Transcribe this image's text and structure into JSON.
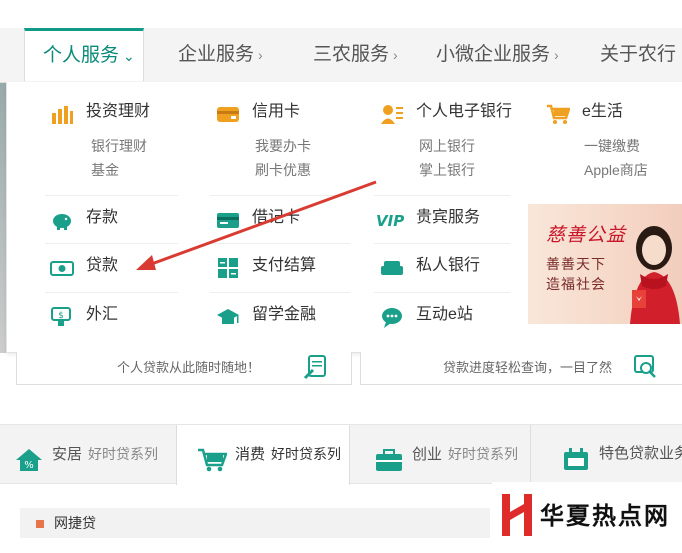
{
  "nav": {
    "tabs": [
      {
        "label": "个人服务",
        "active": true
      },
      {
        "label": "企业服务"
      },
      {
        "label": "三农服务"
      },
      {
        "label": "小微企业服务"
      },
      {
        "label": "关于农行"
      }
    ],
    "chevron_down": "⌄",
    "chevron_right": "›"
  },
  "menu": {
    "col1": {
      "head": "投资理财",
      "subs": [
        "银行理财",
        "基金"
      ],
      "items": [
        "存款",
        "贷款",
        "外汇"
      ]
    },
    "col2": {
      "head": "信用卡",
      "subs": [
        "我要办卡",
        "刷卡优惠"
      ],
      "items": [
        "借记卡",
        "支付结算",
        "留学金融"
      ]
    },
    "col3": {
      "head": "个人电子银行",
      "subs": [
        "网上银行",
        "掌上银行"
      ],
      "items": [
        "贵宾服务",
        "私人银行",
        "互动e站"
      ]
    },
    "col4": {
      "head": "e生活",
      "subs": [
        "一键缴费",
        "Apple商店"
      ]
    }
  },
  "promo": {
    "title": "慈善公益",
    "line1": "善善天下",
    "line2": "造福社会"
  },
  "cards": {
    "left": "个人贷款从此随时随地！",
    "right": "贷款进度轻松查询，一目了然"
  },
  "categories": [
    {
      "label": "安居",
      "sub": "好时贷系列"
    },
    {
      "label": "消费",
      "sub": "好时贷系列",
      "active": true
    },
    {
      "label": "创业",
      "sub": "好时贷系列"
    },
    {
      "label": "特色贷款业务",
      "sub": ""
    }
  ],
  "section": {
    "title": "网捷贷"
  },
  "watermark": {
    "text": "华夏热点网"
  },
  "colors": {
    "accent": "#119b87",
    "icon_orange": "#f0a020",
    "icon_teal": "#1aa08a",
    "arrow": "#d93a32"
  }
}
